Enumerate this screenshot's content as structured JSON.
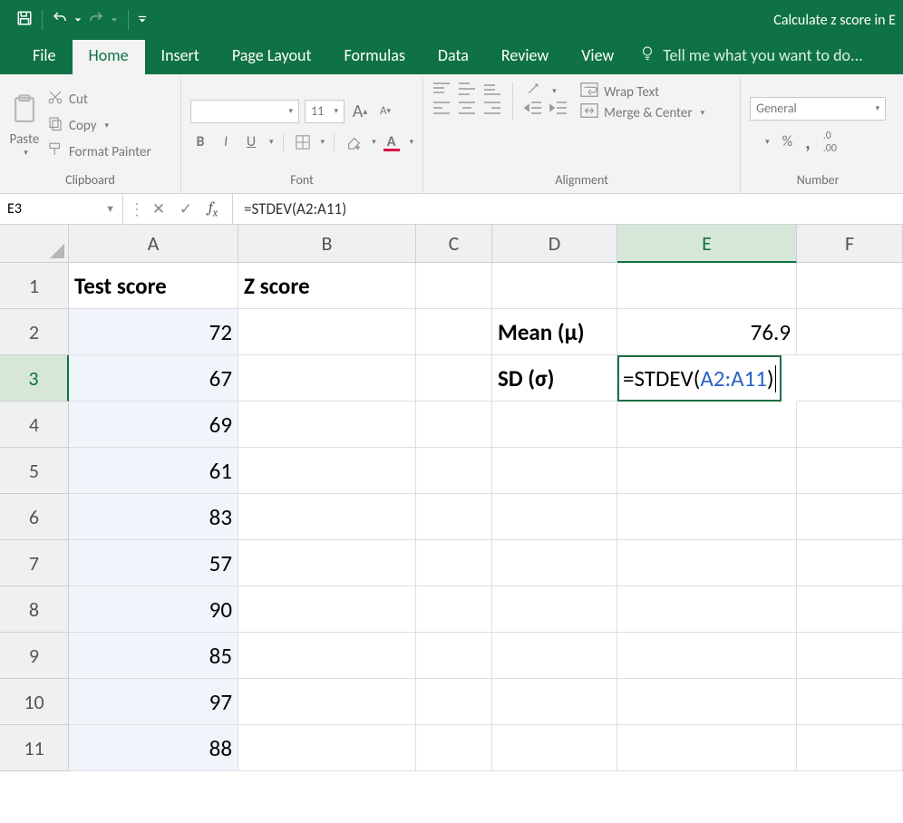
{
  "titlebar": {
    "doc_title": "Calculate z score in E"
  },
  "menu": {
    "file": "File",
    "home": "Home",
    "insert": "Insert",
    "page_layout": "Page Layout",
    "formulas": "Formulas",
    "data": "Data",
    "review": "Review",
    "view": "View",
    "tell_me": "Tell me what you want to do..."
  },
  "ribbon": {
    "clipboard": {
      "paste": "Paste",
      "cut": "Cut",
      "copy": "Copy",
      "format_painter": "Format Painter",
      "label": "Clipboard"
    },
    "font": {
      "name": "",
      "size": "11",
      "label": "Font"
    },
    "alignment": {
      "wrap": "Wrap Text",
      "merge": "Merge & Center",
      "label": "Alignment"
    },
    "number": {
      "format": "General",
      "label": "Number"
    }
  },
  "namebox": "E3",
  "formula_bar": "=STDEV(A2:A11)",
  "columns": [
    "A",
    "B",
    "C",
    "D",
    "E",
    "F"
  ],
  "rows": [
    "1",
    "2",
    "3",
    "4",
    "5",
    "6",
    "7",
    "8",
    "9",
    "10",
    "11"
  ],
  "sheet": {
    "A1": "Test score",
    "B1": "Z score",
    "A2": "72",
    "A3": "67",
    "A4": "69",
    "A5": "61",
    "A6": "83",
    "A7": "57",
    "A8": "90",
    "A9": "85",
    "A10": "97",
    "A11": "88",
    "D2": "Mean (μ)",
    "E2": "76.9",
    "D3": "SD (σ)"
  },
  "editing_cell": {
    "prefix": "=STDEV(",
    "ref": "A2:A11",
    "suffix": ")"
  },
  "selected_col": "E",
  "selected_row": "3"
}
